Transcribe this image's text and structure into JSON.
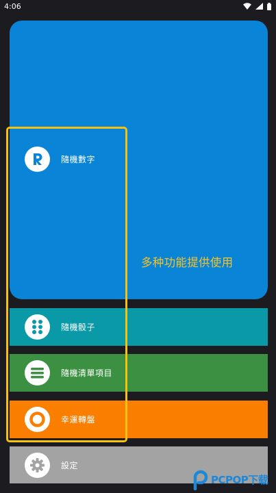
{
  "status_bar": {
    "time": "4:06",
    "icons": [
      "wifi-icon",
      "signal-icon",
      "battery-icon"
    ]
  },
  "menu": {
    "items": [
      {
        "label": "隨機數字",
        "icon": "r-letter-icon",
        "color": "#0a84d6"
      },
      {
        "label": "隨機骰子",
        "icon": "dice-six-dots-icon",
        "color": "#0a99a6"
      },
      {
        "label": "隨機清單項目",
        "icon": "list-lines-icon",
        "color": "#3b9141"
      },
      {
        "label": "幸運轉盤",
        "icon": "ring-icon",
        "color": "#fa7f00"
      },
      {
        "label": "設定",
        "icon": "gear-icon",
        "color": "#a3a3a3"
      }
    ]
  },
  "promo": {
    "text": "多种功能提供使用",
    "color": "#f4c328"
  },
  "highlight": {
    "color": "#f7c20d"
  },
  "watermark": {
    "text": "PCPOP下载",
    "color": "#1e88d8"
  }
}
